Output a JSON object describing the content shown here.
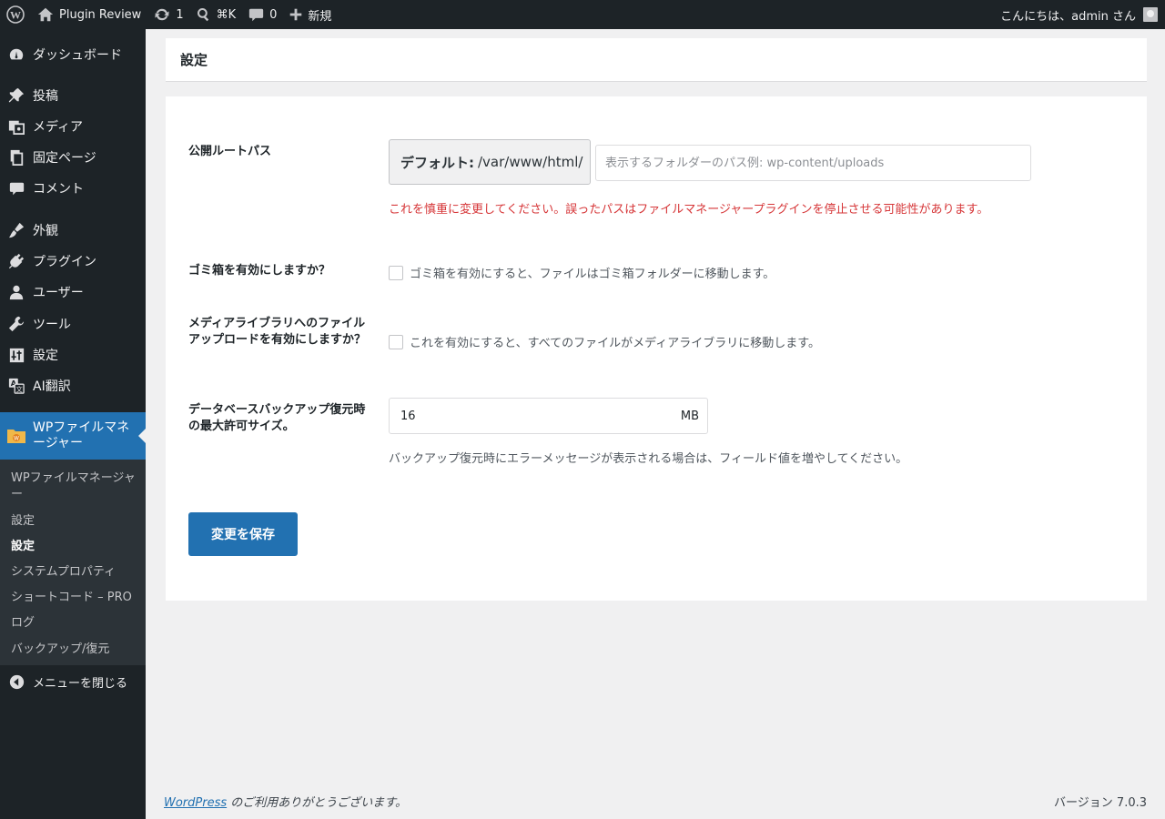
{
  "adminbar": {
    "site_name": "Plugin Review",
    "updates_count": "1",
    "search_shortcut": "⌘K",
    "comments_count": "0",
    "new_label": "新規",
    "greeting": "こんにちは、admin さん"
  },
  "sidebar": {
    "items": [
      {
        "label": "ダッシュボード",
        "icon": "dashboard-icon"
      },
      {
        "label": "投稿",
        "icon": "pin-icon"
      },
      {
        "label": "メディア",
        "icon": "media-icon"
      },
      {
        "label": "固定ページ",
        "icon": "pages-icon"
      },
      {
        "label": "コメント",
        "icon": "comment-icon"
      },
      {
        "label": "外観",
        "icon": "brush-icon"
      },
      {
        "label": "プラグイン",
        "icon": "plugin-icon"
      },
      {
        "label": "ユーザー",
        "icon": "user-icon"
      },
      {
        "label": "ツール",
        "icon": "wrench-icon"
      },
      {
        "label": "設定",
        "icon": "settings-sliders-icon"
      },
      {
        "label": "AI翻訳",
        "icon": "translate-icon"
      }
    ],
    "current": {
      "label": "WPファイルマネージャー",
      "icon": "file-manager-icon"
    },
    "submenu": [
      "WPファイルマネージャー",
      "設定",
      "設定",
      "システムプロパティ",
      "ショートコード – PRO",
      "ログ",
      "バックアップ/復元"
    ],
    "collapse_label": "メニューを閉じる"
  },
  "page": {
    "title": "設定",
    "public_root": {
      "label": "公開ルートパス",
      "prefix_bold": "デフォルト:",
      "prefix_path": "/var/www/html/",
      "placeholder": "表示するフォルダーのパス例: wp-content/uploads",
      "warning": "これを慎重に変更してください。誤ったパスはファイルマネージャープラグインを停止させる可能性があります。"
    },
    "trash": {
      "label": "ゴミ箱を有効にしますか？",
      "description": "ゴミ箱を有効にすると、ファイルはゴミ箱フォルダーに移動します。",
      "checked": false
    },
    "media_upload": {
      "label": "メディアライブラリへのファイルアップロードを有効にしますか？",
      "description": "これを有効にすると、すべてのファイルがメディアライブラリに移動します。",
      "checked": false
    },
    "backup_size": {
      "label": "データベースバックアップ復元時の最大許可サイズ。",
      "value": "16",
      "unit": "MB",
      "help": "バックアップ復元時にエラーメッセージが表示される場合は、フィールド値を増やしてください。"
    },
    "save_label": "変更を保存"
  },
  "footer": {
    "link": "WordPress",
    "thanks": " のご利用ありがとうございます。",
    "version": "バージョン 7.0.3"
  },
  "colors": {
    "admin_dark": "#1d2327",
    "accent": "#2271b1",
    "warning": "#d63638"
  }
}
